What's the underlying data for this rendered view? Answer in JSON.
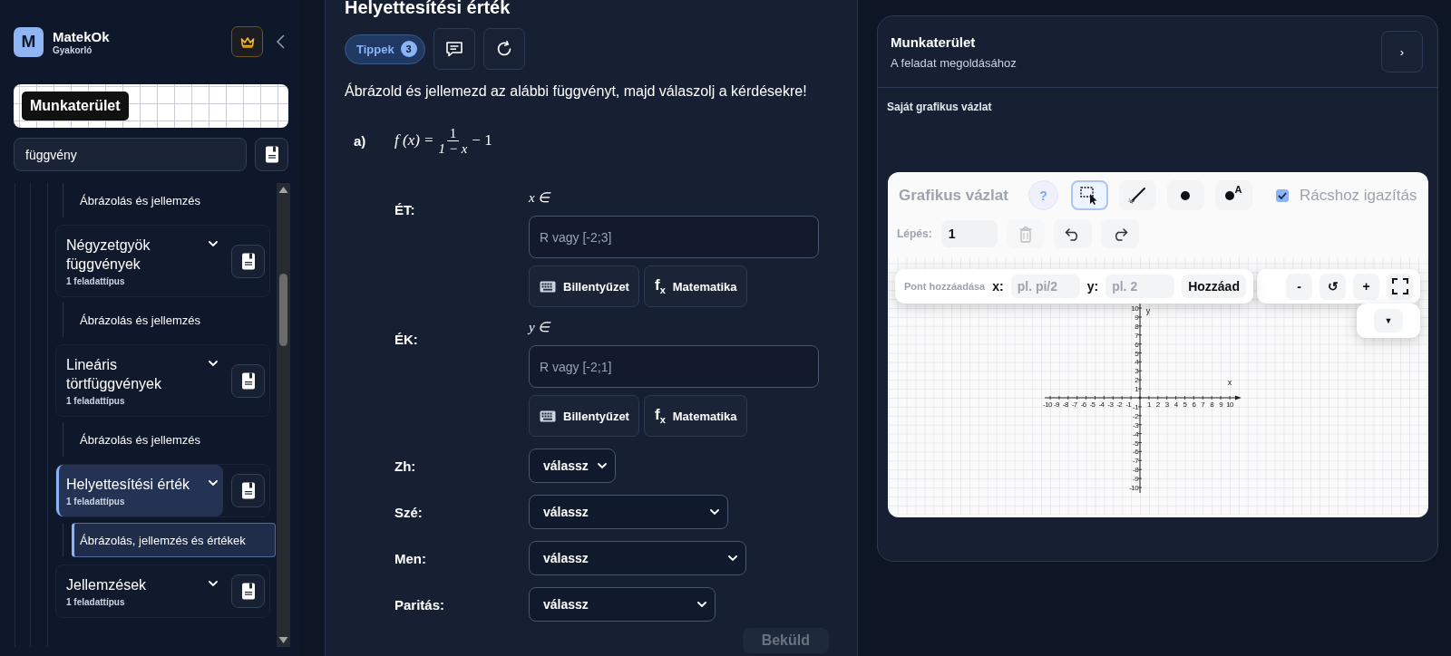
{
  "sidebar": {
    "logo_letter": "M",
    "app_name": "MatekOk",
    "app_subtitle": "Gyakorló",
    "workspace_label": "Munkaterület",
    "search": {
      "value": "függvény"
    },
    "tree": [
      {
        "kind": "subitem",
        "label": "Ábrázolás és jellemzés",
        "selected": false
      },
      {
        "kind": "topic",
        "title": "Négyzetgyök függvények",
        "count": "1 feladattípus",
        "selected": false,
        "children": [
          {
            "label": "Ábrázolás és jellemzés",
            "selected": false
          }
        ]
      },
      {
        "kind": "topic",
        "title": "Lineáris törtfüggvények",
        "count": "1 feladattípus",
        "selected": false,
        "children": [
          {
            "label": "Ábrázolás és jellemzés",
            "selected": false
          }
        ]
      },
      {
        "kind": "topic",
        "title": "Helyettesítési érték",
        "count": "1 feladattípus",
        "selected": true,
        "children": [
          {
            "label": "Ábrázolás, jellemzés és értékek",
            "selected": true
          }
        ]
      },
      {
        "kind": "topic",
        "title": "Jellemzések",
        "count": "1 feladattípus",
        "selected": false
      }
    ]
  },
  "task": {
    "title": "Helyettesítési érték",
    "tips": {
      "label": "Tippek",
      "count": "3"
    },
    "instruction": "Ábrázold és jellemezd az alábbi függvényt, majd válaszolj a kérdésekre!",
    "part_label": "a)",
    "formula": {
      "lhs": "f (x) =",
      "numerator": "1",
      "denominator": "1 − x",
      "rhs": "− 1"
    },
    "fields": [
      {
        "kind": "text",
        "label": "ÉT:",
        "prefix": "x ∈",
        "placeholder": "R vagy [-2;3]",
        "buttons": [
          {
            "kind": "keyboard",
            "label": "Billentyűzet"
          },
          {
            "kind": "math",
            "symbol": "f$_{x}$",
            "label": "Matematika"
          }
        ]
      },
      {
        "kind": "text",
        "label": "ÉK:",
        "prefix": "y ∈",
        "placeholder": "R vagy [-2;1]",
        "buttons": [
          {
            "kind": "keyboard",
            "label": "Billentyűzet"
          },
          {
            "kind": "math",
            "symbol": "f$_{x}$",
            "label": "Matematika"
          }
        ]
      },
      {
        "kind": "select",
        "label": "Zh:",
        "value": "válassz"
      },
      {
        "kind": "select",
        "label": "Szé:",
        "value": "válassz"
      },
      {
        "kind": "select",
        "label": "Men:",
        "value": "válassz"
      },
      {
        "kind": "select",
        "label": "Paritás:",
        "value": "válassz"
      }
    ],
    "submit": {
      "label": "Beküld",
      "disabled": true
    }
  },
  "workspace": {
    "title": "Munkaterület",
    "subtitle": "A feladat megoldásához",
    "collapse_button": "›",
    "section_label": "Saját grafikus vázlat",
    "sketch": {
      "title": "Grafikus vázlat",
      "help_button": "?",
      "tools": [
        {
          "kind": "select",
          "selected": true
        },
        {
          "kind": "brush",
          "selected": false
        },
        {
          "kind": "point",
          "selected": false
        },
        {
          "kind": "labeled_point",
          "label": "A",
          "selected": false
        }
      ],
      "snap": {
        "label": "Rácshoz igazítás",
        "checked": true
      },
      "step": {
        "label": "Lépés:",
        "value": "1"
      },
      "history_buttons": [
        {
          "kind": "delete",
          "disabled": true
        },
        {
          "kind": "undo",
          "disabled": false
        },
        {
          "kind": "redo",
          "disabled": false
        }
      ],
      "point_add": {
        "label": "Pont hozzáadása",
        "x_label": "x:",
        "x_placeholder": "pl. pi/2",
        "y_label": "y:",
        "y_placeholder": "pl. 2",
        "button": "Hozzáad"
      },
      "zoom_controls": [
        {
          "kind": "zoom_out",
          "label": "-"
        },
        {
          "kind": "reset",
          "label": "↺"
        },
        {
          "kind": "zoom_in",
          "label": "+"
        },
        {
          "kind": "fullscreen"
        }
      ],
      "dropdown_button": "▼",
      "graph": {
        "x_axis_label": "x",
        "y_axis_label": "y",
        "x_tick_labels": [
          "-10",
          "-9",
          "-8",
          "-7",
          "-6",
          "-5",
          "-4",
          "-3",
          "-2",
          "-1",
          "1",
          "2",
          "3",
          "4",
          "5",
          "6",
          "7",
          "8",
          "9",
          "10"
        ],
        "y_tick_labels": [
          "10",
          "9",
          "8",
          "7",
          "6",
          "5",
          "4",
          "3",
          "2",
          "1",
          "-1",
          "-2",
          "-3",
          "-4",
          "-5",
          "-6",
          "-7",
          "-8",
          "-9",
          "-10"
        ]
      }
    }
  }
}
